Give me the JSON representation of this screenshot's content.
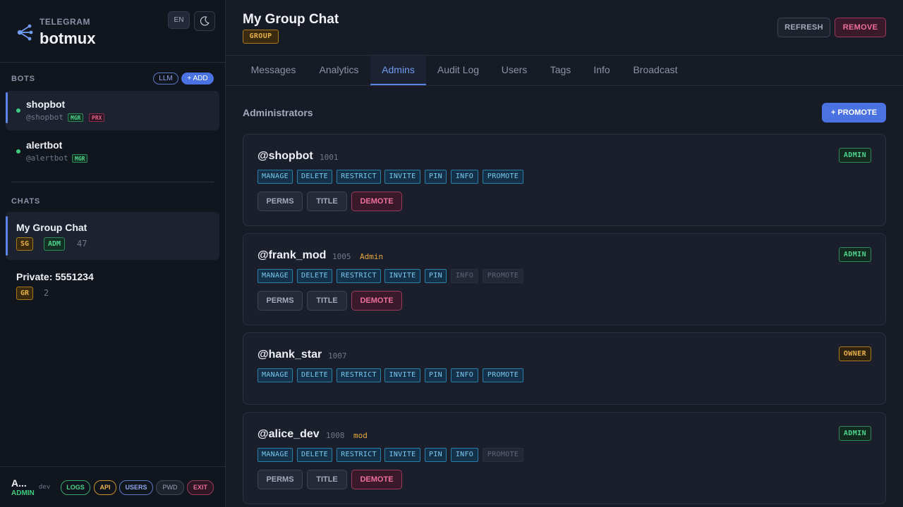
{
  "brand": {
    "subtitle": "TELEGRAM",
    "title": "botmux",
    "lang": "EN"
  },
  "bots": {
    "label": "BOTS",
    "llm_label": "LLM",
    "add_label": "+ ADD",
    "items": [
      {
        "name": "shopbot",
        "handle": "@shopbot",
        "tags": [
          "MGR",
          "PRX"
        ]
      },
      {
        "name": "alertbot",
        "handle": "@alertbot",
        "tags": [
          "MGR"
        ]
      }
    ]
  },
  "chats": {
    "label": "CHATS",
    "items": [
      {
        "name": "My Group Chat",
        "tags": [
          "SG",
          "ADM"
        ],
        "count": "47"
      },
      {
        "name": "Private: 5551234",
        "tags": [
          "GR"
        ],
        "count": "2"
      }
    ]
  },
  "footer": {
    "user": "A...",
    "role": "ADMIN",
    "env": "dev",
    "buttons": {
      "logs": "LOGS",
      "api": "API",
      "users": "USERS",
      "pwd": "PWD",
      "exit": "EXIT"
    }
  },
  "header": {
    "title": "My Group Chat",
    "badge": "GROUP",
    "refresh_label": "REFRESH",
    "remove_label": "REMOVE"
  },
  "tabs": [
    "Messages",
    "Analytics",
    "Admins",
    "Audit Log",
    "Users",
    "Tags",
    "Info",
    "Broadcast"
  ],
  "admins": {
    "heading": "Administrators",
    "promote_label": "+ PROMOTE",
    "perm_labels": [
      "MANAGE",
      "DELETE",
      "RESTRICT",
      "INVITE",
      "PIN",
      "INFO",
      "PROMOTE"
    ],
    "action_labels": {
      "perms": "PERMS",
      "title": "TITLE",
      "demote": "DEMOTE"
    },
    "list": [
      {
        "name": "@shopbot",
        "id": "1001",
        "label": "",
        "role": "ADMIN"
      },
      {
        "name": "@frank_mod",
        "id": "1005",
        "label": "Admin",
        "role": "ADMIN"
      },
      {
        "name": "@hank_star",
        "id": "1007",
        "label": "",
        "role": "OWNER"
      },
      {
        "name": "@alice_dev",
        "id": "1008",
        "label": "mod",
        "role": "ADMIN"
      }
    ]
  },
  "colors": {
    "accent": "#4a72e0",
    "success": "#3ecb7e",
    "danger": "#ee6f9a",
    "warning": "#e7b04a"
  }
}
